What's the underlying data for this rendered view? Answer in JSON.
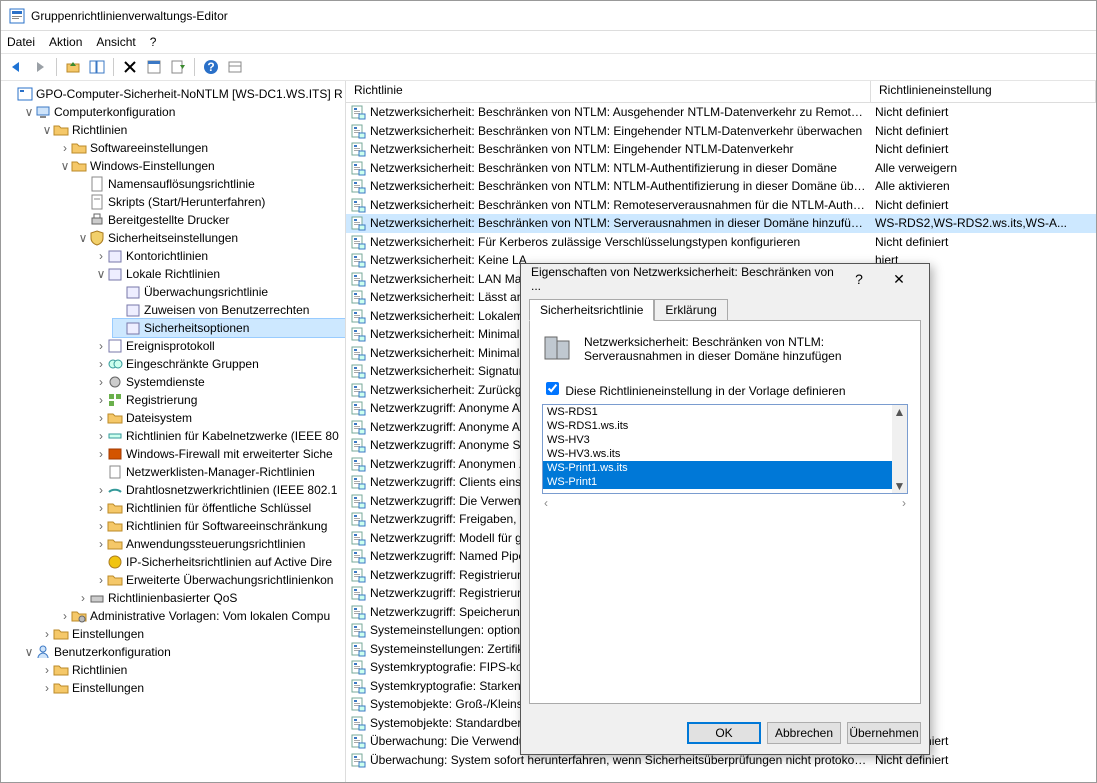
{
  "window": {
    "title": "Gruppenrichtlinienverwaltungs-Editor"
  },
  "menu": {
    "file": "Datei",
    "action": "Aktion",
    "view": "Ansicht",
    "help": "?"
  },
  "root": "GPO-Computer-Sicherheit-NoNTLM [WS-DC1.WS.ITS] R",
  "tree": {
    "computercfg": "Computerkonfiguration",
    "policies": "Richtlinien",
    "sw": "Softwareeinstellungen",
    "win": "Windows-Einstellungen",
    "nameres": "Namensauflösungsrichtlinie",
    "scripts": "Skripts (Start/Herunterfahren)",
    "printers": "Bereitgestellte Drucker",
    "security": "Sicherheitseinstellungen",
    "account": "Kontorichtlinien",
    "local": "Lokale Richtlinien",
    "audit": "Überwachungsrichtlinie",
    "userrights": "Zuweisen von Benutzerrechten",
    "secopt": "Sicherheitsoptionen",
    "eventlog": "Ereignisprotokoll",
    "restr": "Eingeschränkte Gruppen",
    "sysserv": "Systemdienste",
    "registry": "Registrierung",
    "filesys": "Dateisystem",
    "wired": "Richtlinien für Kabelnetzwerke (IEEE 80",
    "firewall": "Windows-Firewall mit erweiterter Siche",
    "netlist": "Netzwerklisten-Manager-Richtlinien",
    "wireless": "Drahtlosnetzwerkrichtlinien (IEEE 802.1",
    "pubkey": "Richtlinien für öffentliche Schlüssel",
    "swrestrict": "Richtlinien für Softwareeinschränkung",
    "appctrl": "Anwendungssteuerungsrichtlinien",
    "ipsec": "IP-Sicherheitsrichtlinien auf Active Dire",
    "advaudit": "Erweiterte Überwachungsrichtlinienkon",
    "qos": "Richtlinienbasierter QoS",
    "admtmpl": "Administrative Vorlagen: Vom lokalen Compu",
    "prefs": "Einstellungen",
    "usercfg": "Benutzerkonfiguration",
    "upolicies": "Richtlinien",
    "uprefs": "Einstellungen"
  },
  "listheader": {
    "policy": "Richtlinie",
    "setting": "Richtlinieneinstellung"
  },
  "notdef": "Nicht definiert",
  "hiert": "hiert",
  "policies": [
    {
      "name": "Netzwerksicherheit: Beschränken von NTLM: Ausgehender NTLM-Datenverkehr zu Remoteserv...",
      "setting": "Nicht definiert"
    },
    {
      "name": "Netzwerksicherheit: Beschränken von NTLM: Eingehender NTLM-Datenverkehr überwachen",
      "setting": "Nicht definiert"
    },
    {
      "name": "Netzwerksicherheit: Beschränken von NTLM: Eingehender NTLM-Datenverkehr",
      "setting": "Nicht definiert"
    },
    {
      "name": "Netzwerksicherheit: Beschränken von NTLM: NTLM-Authentifizierung in dieser Domäne",
      "setting": "Alle verweigern"
    },
    {
      "name": "Netzwerksicherheit: Beschränken von NTLM: NTLM-Authentifizierung in dieser Domäne überw...",
      "setting": "Alle aktivieren"
    },
    {
      "name": "Netzwerksicherheit: Beschränken von NTLM: Remoteserverausnahmen für die NTLM-Authentif...",
      "setting": "Nicht definiert"
    },
    {
      "name": "Netzwerksicherheit: Beschränken von NTLM: Serverausnahmen in dieser Domäne hinzufügen",
      "setting": "WS-RDS2,WS-RDS2.ws.its,WS-A...",
      "sel": true
    },
    {
      "name": "Netzwerksicherheit: Für Kerberos zulässige Verschlüsselungstypen konfigurieren",
      "setting": "Nicht definiert"
    },
    {
      "name": "Netzwerksicherheit: Keine LA"
    },
    {
      "name": "Netzwerksicherheit: LAN Man"
    },
    {
      "name": "Netzwerksicherheit: Lässt an"
    },
    {
      "name": "Netzwerksicherheit: Lokalem"
    },
    {
      "name": "Netzwerksicherheit: Minimale"
    },
    {
      "name": "Netzwerksicherheit: Minimale"
    },
    {
      "name": "Netzwerksicherheit: Signatura"
    },
    {
      "name": "Netzwerksicherheit: Zurückgr"
    },
    {
      "name": "Netzwerkzugriff: Anonyme Au"
    },
    {
      "name": "Netzwerkzugriff: Anonyme Au"
    },
    {
      "name": "Netzwerkzugriff: Anonyme SI"
    },
    {
      "name": "Netzwerkzugriff: Anonymen Z"
    },
    {
      "name": "Netzwerkzugriff: Clients einsc"
    },
    {
      "name": "Netzwerkzugriff: Die Verwend"
    },
    {
      "name": "Netzwerkzugriff: Freigaben, a"
    },
    {
      "name": "Netzwerkzugriff: Modell für g"
    },
    {
      "name": "Netzwerkzugriff: Named Pipe"
    },
    {
      "name": "Netzwerkzugriff: Registrierun"
    },
    {
      "name": "Netzwerkzugriff: Registrierun"
    },
    {
      "name": "Netzwerkzugriff: Speicherung"
    },
    {
      "name": "Systemeinstellungen: optiona"
    },
    {
      "name": "Systemeinstellungen: Zertifika"
    },
    {
      "name": "Systemkryptografie: FIPS-kon"
    },
    {
      "name": "Systemkryptografie: Starken S"
    },
    {
      "name": "Systemobjekte: Groß-/Kleinsc"
    },
    {
      "name": "Systemobjekte: Standardbere"
    },
    {
      "name": "Überwachung: Die Verwendung des Sicherungs- und Wiederherstellungsrechtes überprüfen",
      "setting": "Nicht definiert"
    },
    {
      "name": "Überwachung: System sofort herunterfahren, wenn Sicherheitsüberprüfungen nicht protokollie",
      "setting": "Nicht definiert"
    }
  ],
  "dialog": {
    "title": "Eigenschaften von Netzwerksicherheit: Beschränken von ...",
    "tab1": "Sicherheitsrichtlinie",
    "tab2": "Erklärung",
    "desc": "Netzwerksicherheit: Beschränken von NTLM: Serverausnahmen in dieser Domäne hinzufügen",
    "checkbox": "Diese Richtlinieneinstellung in der Vorlage definieren",
    "items": [
      "WS-RDS1",
      "WS-RDS1.ws.its",
      "WS-HV3",
      "WS-HV3.ws.its",
      "WS-Print1.ws.its",
      "WS-Print1"
    ],
    "ok": "OK",
    "cancel": "Abbrechen",
    "apply": "Übernehmen"
  }
}
